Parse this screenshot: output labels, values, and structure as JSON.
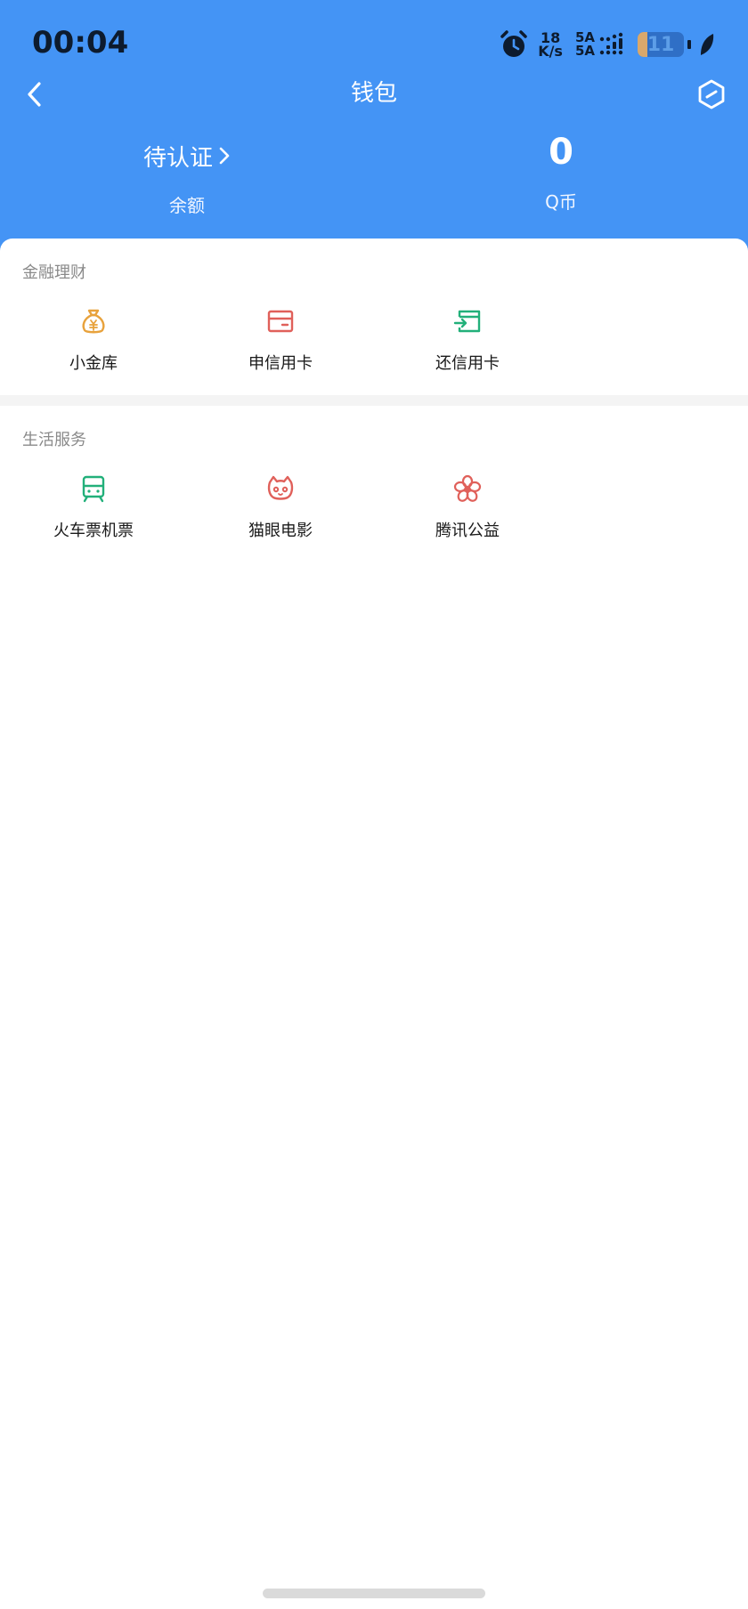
{
  "status_bar": {
    "time": "00:04",
    "net_speed_value": "18",
    "net_speed_unit": "K/s",
    "signal_1": "5A",
    "signal_2": "5A",
    "battery_level": "11"
  },
  "nav": {
    "title": "钱包"
  },
  "balance": {
    "status_text": "待认证",
    "balance_label": "余额",
    "q_coin_value": "0",
    "q_coin_label": "Q币"
  },
  "sections": [
    {
      "title": "金融理财",
      "items": [
        {
          "label": "小金库",
          "icon": "money-bag-icon",
          "color": "#E8A23C"
        },
        {
          "label": "申信用卡",
          "icon": "credit-card-icon",
          "color": "#E0605A"
        },
        {
          "label": "还信用卡",
          "icon": "card-repay-icon",
          "color": "#22B07A"
        }
      ]
    },
    {
      "title": "生活服务",
      "items": [
        {
          "label": "火车票机票",
          "icon": "train-icon",
          "color": "#22B07A"
        },
        {
          "label": "猫眼电影",
          "icon": "cat-icon",
          "color": "#E0605A"
        },
        {
          "label": "腾讯公益",
          "icon": "flower-icon",
          "color": "#E0605A"
        }
      ]
    }
  ],
  "colors": {
    "header_blue": "#4494F5",
    "orange": "#E8A23C",
    "red": "#E0605A",
    "green": "#22B07A"
  }
}
